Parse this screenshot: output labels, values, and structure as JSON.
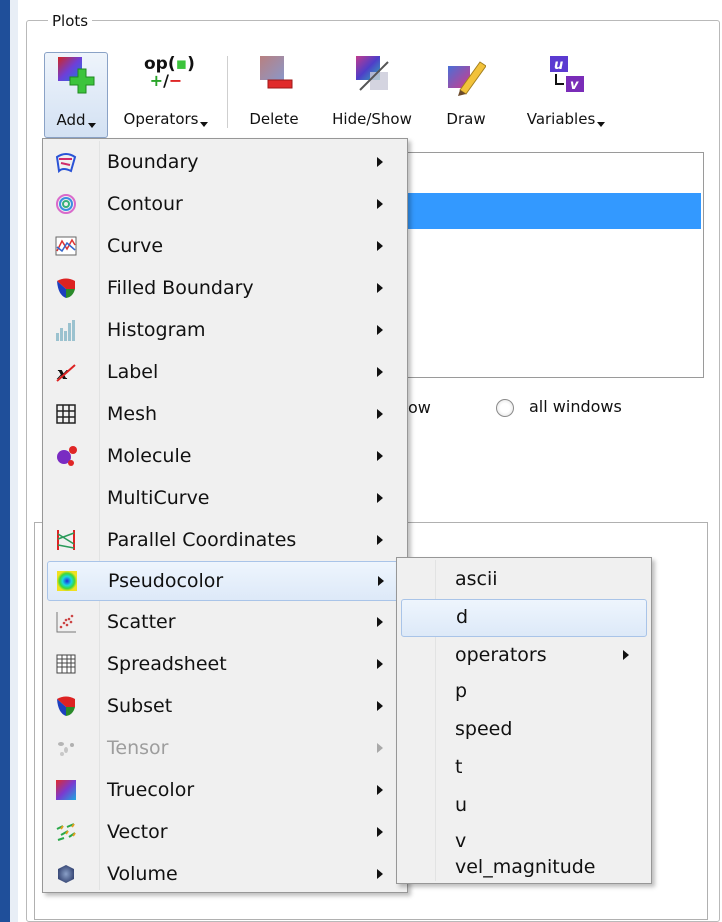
{
  "plots_group": {
    "title": "Plots",
    "toolbar": {
      "add": "Add",
      "operators_icon_text": "op(",
      "operators": "Operators",
      "delete": "Delete",
      "hide_show": "Hide/Show",
      "draw": "Draw",
      "variables": "Variables"
    },
    "apply_to": {
      "partial_label": "ow",
      "all_windows": "all windows"
    }
  },
  "add_menu": {
    "items": [
      {
        "label": "Boundary",
        "icon": "boundary-icon",
        "enabled": true
      },
      {
        "label": "Contour",
        "icon": "contour-icon",
        "enabled": true
      },
      {
        "label": "Curve",
        "icon": "curve-icon",
        "enabled": true
      },
      {
        "label": "Filled Boundary",
        "icon": "filled-boundary-icon",
        "enabled": true
      },
      {
        "label": "Histogram",
        "icon": "histogram-icon",
        "enabled": true
      },
      {
        "label": "Label",
        "icon": "label-icon",
        "enabled": true
      },
      {
        "label": "Mesh",
        "icon": "mesh-icon",
        "enabled": true
      },
      {
        "label": "Molecule",
        "icon": "molecule-icon",
        "enabled": true
      },
      {
        "label": "MultiCurve",
        "icon": "",
        "enabled": true
      },
      {
        "label": "Parallel Coordinates",
        "icon": "parallel-coordinates-icon",
        "enabled": true
      },
      {
        "label": "Pseudocolor",
        "icon": "pseudocolor-icon",
        "enabled": true,
        "highlighted": true
      },
      {
        "label": "Scatter",
        "icon": "scatter-icon",
        "enabled": true
      },
      {
        "label": "Spreadsheet",
        "icon": "spreadsheet-icon",
        "enabled": true
      },
      {
        "label": "Subset",
        "icon": "subset-icon",
        "enabled": true
      },
      {
        "label": "Tensor",
        "icon": "tensor-icon",
        "enabled": false
      },
      {
        "label": "Truecolor",
        "icon": "truecolor-icon",
        "enabled": true
      },
      {
        "label": "Vector",
        "icon": "vector-icon",
        "enabled": true
      },
      {
        "label": "Volume",
        "icon": "volume-icon",
        "enabled": true
      }
    ]
  },
  "pseudocolor_submenu": {
    "items": [
      {
        "label": "ascii"
      },
      {
        "label": "d",
        "highlighted": true
      },
      {
        "label": "operators",
        "has_submenu": true
      },
      {
        "label": "p"
      },
      {
        "label": "speed"
      },
      {
        "label": "t"
      },
      {
        "label": "u"
      },
      {
        "label": "v"
      },
      {
        "label": "vel_magnitude"
      }
    ]
  },
  "colors": {
    "selection": "#3399ff",
    "menu_bg": "#f0f0f0",
    "highlight_border": "#a9c4e8",
    "window_edge": "#1f4f9a"
  }
}
